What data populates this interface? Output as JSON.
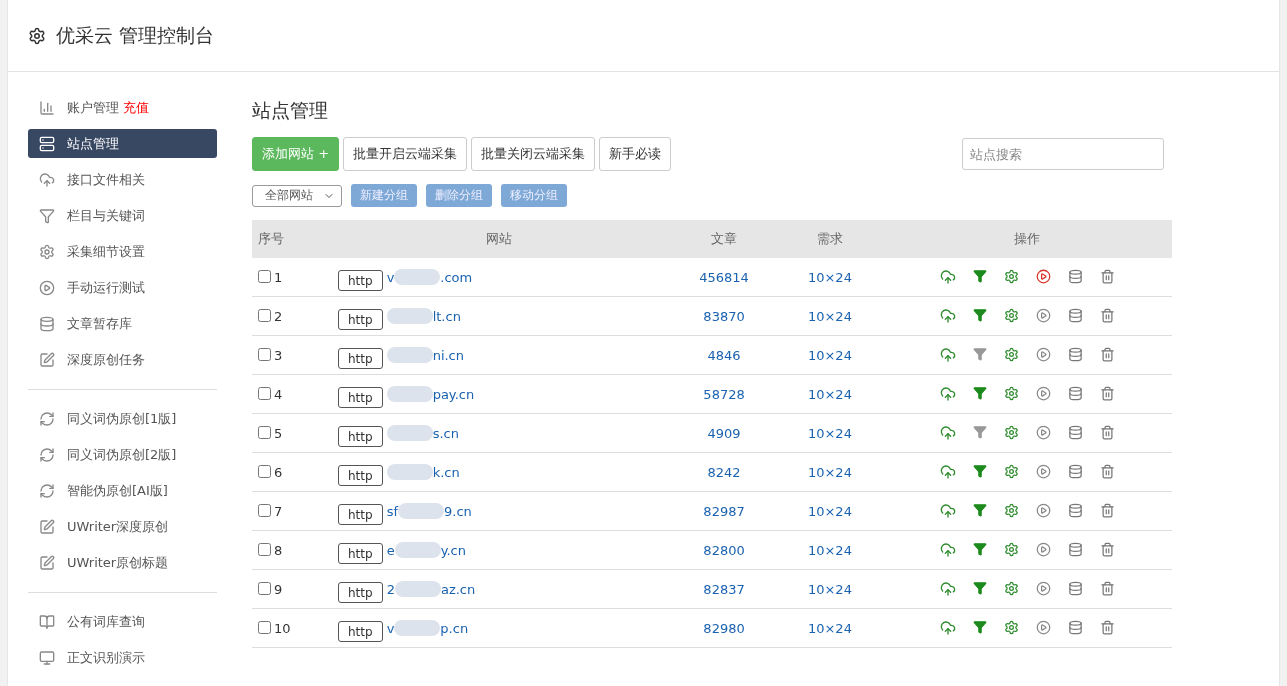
{
  "header": {
    "title": "优采云 管理控制台"
  },
  "sidebar": {
    "groups": [
      [
        {
          "kind": "chart",
          "label": "账户管理",
          "badge": "充值",
          "selected": false
        },
        {
          "kind": "server",
          "label": "站点管理",
          "selected": true
        },
        {
          "kind": "cloud",
          "label": "接口文件相关",
          "selected": false
        },
        {
          "kind": "filter",
          "label": "栏目与关键词",
          "selected": false
        },
        {
          "kind": "gears",
          "label": "采集细节设置",
          "selected": false
        },
        {
          "kind": "play",
          "label": "手动运行测试",
          "selected": false
        },
        {
          "kind": "database",
          "label": "文章暂存库",
          "selected": false
        },
        {
          "kind": "edit",
          "label": "深度原创任务",
          "selected": false
        }
      ],
      [
        {
          "kind": "refresh",
          "label": "同义词伪原创[1版]",
          "selected": false
        },
        {
          "kind": "refresh",
          "label": "同义词伪原创[2版]",
          "selected": false
        },
        {
          "kind": "refresh",
          "label": "智能伪原创[AI版]",
          "selected": false
        },
        {
          "kind": "edit",
          "label": "UWriter深度原创",
          "selected": false
        },
        {
          "kind": "edit",
          "label": "UWriter原创标题",
          "selected": false
        }
      ],
      [
        {
          "kind": "book",
          "label": "公有词库查询",
          "selected": false
        },
        {
          "kind": "monitor",
          "label": "正文识别演示",
          "selected": false
        }
      ]
    ]
  },
  "main": {
    "title": "站点管理",
    "buttons": [
      {
        "label": "添加网站 +",
        "kind": "primary"
      },
      {
        "label": "批量开启云端采集",
        "kind": "default"
      },
      {
        "label": "批量关闭云端采集",
        "kind": "default"
      },
      {
        "label": "新手必读",
        "kind": "default"
      }
    ],
    "search": {
      "placeholder": "站点搜索"
    },
    "group_select": {
      "value": "全部网站"
    },
    "group_buttons": [
      "新建分组",
      "删除分组",
      "移动分组"
    ],
    "table": {
      "columns": [
        "序号",
        "网站",
        "文章",
        "需求",
        "操作"
      ],
      "rows": [
        {
          "checked": false,
          "no": "1",
          "protocol": "http",
          "domain_start": "v",
          "domain_end": ".com",
          "articles": "456814",
          "demand": "10×24",
          "filter_on": true,
          "running": true
        },
        {
          "checked": false,
          "no": "2",
          "protocol": "http",
          "domain_end": "lt.cn",
          "articles": "83870",
          "demand": "10×24",
          "filter_on": true,
          "running": false
        },
        {
          "checked": false,
          "no": "3",
          "protocol": "http",
          "domain_end": "ni.cn",
          "articles": "4846",
          "demand": "10×24",
          "filter_on": false,
          "running": false
        },
        {
          "checked": false,
          "no": "4",
          "protocol": "http",
          "domain_end": "pay.cn",
          "articles": "58728",
          "demand": "10×24",
          "filter_on": true,
          "running": false
        },
        {
          "checked": false,
          "no": "5",
          "protocol": "http",
          "domain_end": "s.cn",
          "articles": "4909",
          "demand": "10×24",
          "filter_on": false,
          "running": false
        },
        {
          "checked": false,
          "no": "6",
          "protocol": "http",
          "domain_end": "k.cn",
          "articles": "8242",
          "demand": "10×24",
          "filter_on": true,
          "running": false
        },
        {
          "checked": false,
          "no": "7",
          "protocol": "http",
          "domain_start": "sf",
          "domain_end": "9.cn",
          "articles": "82987",
          "demand": "10×24",
          "filter_on": true,
          "running": false
        },
        {
          "checked": false,
          "no": "8",
          "protocol": "http",
          "domain_start": "e",
          "domain_end": "y.cn",
          "articles": "82800",
          "demand": "10×24",
          "filter_on": true,
          "running": false
        },
        {
          "checked": false,
          "no": "9",
          "protocol": "http",
          "domain_start": "2",
          "domain_end": "az.cn",
          "articles": "82837",
          "demand": "10×24",
          "filter_on": true,
          "running": false
        },
        {
          "checked": false,
          "no": "10",
          "protocol": "http",
          "domain_start": "v",
          "domain_end": "p.cn",
          "articles": "82980",
          "demand": "10×24",
          "filter_on": true,
          "running": false
        }
      ]
    }
  }
}
